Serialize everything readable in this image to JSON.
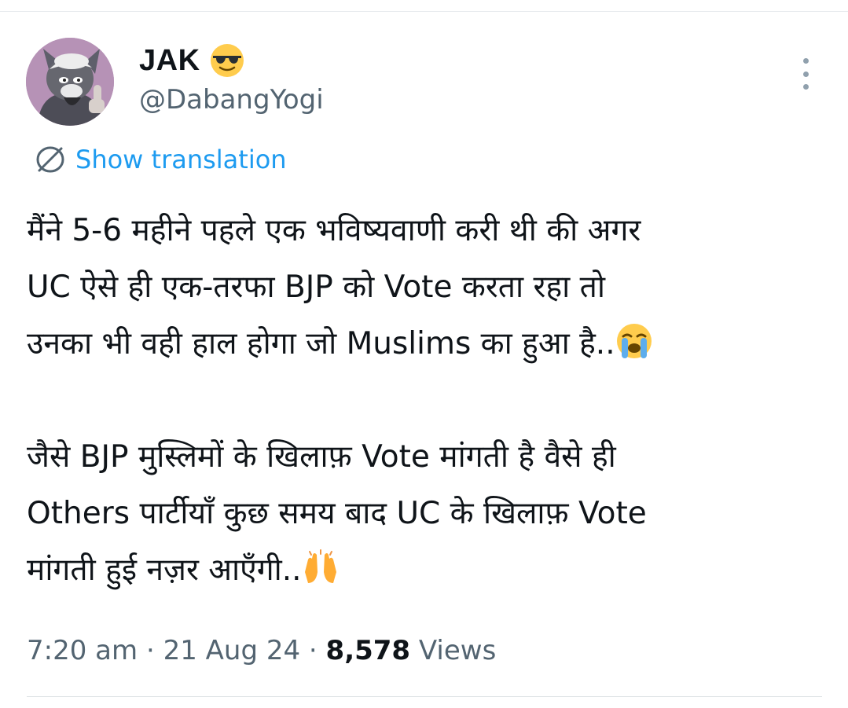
{
  "tweet": {
    "author": {
      "display_name": "JAK",
      "name_emoji": "sunglasses-emoji",
      "handle": "@DabangYogi"
    },
    "translate_label": "Show translation",
    "paragraphs": [
      "मैंने 5-6 महीने पहले एक भविष्यवाणी करी थी की अगर\nUC ऐसे ही एक-तरफा BJP को Vote करता रहा तो\nउनका भी वही हाल होगा जो Muslims का हुआ है..",
      "जैसे BJP मुस्लिमों के खिलाफ़ Vote मांगती है वैसे ही\nOthers पार्टीयाँ कुछ समय बाद UC के खिलाफ़ Vote\nमांगती हुई नज़र आएँगी.."
    ],
    "paragraph_emojis": [
      "loudly-crying-emoji",
      "raising-hands-emoji"
    ],
    "time": "7:20 am",
    "separator": "·",
    "date": "21 Aug 24",
    "views_count": "8,578",
    "views_label": "Views"
  },
  "colors": {
    "accent": "#1d9bf0",
    "secondary_text": "#536471",
    "primary_text": "#0f1419"
  }
}
